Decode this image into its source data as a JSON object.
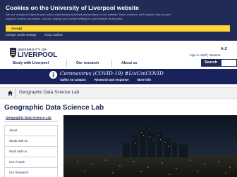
{
  "cookie": {
    "title": "Cookies on the University of Liverpool website",
    "body_line1": "We use cookies to improve your online experiences and track performance of our website. If you continue, we'll assume that you are",
    "body_line2": "happy to receive all cookies. You can change your cookie settings in your browser at any time.",
    "accept_label": "Accept",
    "change_label": "Change cookie settings",
    "about_label": "About cookies"
  },
  "header": {
    "logo_top": "UNIVERSITY OF",
    "logo_main": "LIVERPOOL",
    "az_label": "A-Z",
    "signin_label": "Sign in: Staff | Students"
  },
  "nav": {
    "items": [
      "Study with Liverpool",
      "Our research",
      "About us"
    ],
    "search_label": "Search"
  },
  "covid": {
    "title": "Coronavirus (COVID-19) #LivUniCOVID",
    "links": [
      "Safety on campus",
      "Research and response",
      "More info"
    ]
  },
  "breadcrumb": {
    "current": "Geographic Data Science Lab"
  },
  "page": {
    "title": "Geographic Data Science Lab"
  },
  "side_nav": {
    "heading": "Geographic Data Science Lab",
    "items": [
      "About",
      "Study with us",
      "Work with us",
      "Our People",
      "Our Research"
    ]
  },
  "colors": {
    "navy": "#212b58",
    "accept_yellow": "#fed733",
    "covid_bg": "#19225a"
  },
  "icons": {
    "crest": "university-crest-icon",
    "home": "home-icon",
    "covid": "info-circle-icon"
  }
}
